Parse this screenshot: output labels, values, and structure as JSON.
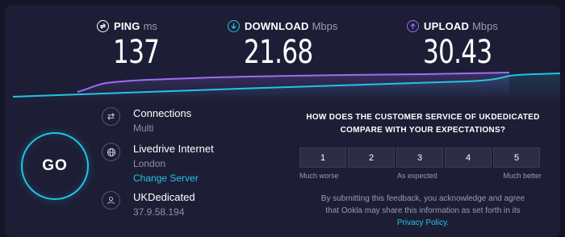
{
  "metrics": {
    "ping": {
      "label": "PING",
      "unit": "ms",
      "value": "137",
      "icon": "ping-icon",
      "color": "#ffffff"
    },
    "download": {
      "label": "DOWNLOAD",
      "unit": "Mbps",
      "value": "21.68",
      "icon": "download-arrow-icon",
      "color": "#24c3e3"
    },
    "upload": {
      "label": "UPLOAD",
      "unit": "Mbps",
      "value": "30.43",
      "icon": "upload-arrow-icon",
      "color": "#9b6ef3"
    }
  },
  "go_label": "GO",
  "connections": {
    "title": "Connections",
    "value": "Multi",
    "icon": "connections-icon"
  },
  "server": {
    "name": "Livedrive Internet",
    "location": "London",
    "change_label": "Change Server",
    "icon": "globe-icon"
  },
  "provider": {
    "name": "UKDedicated",
    "ip": "37.9.58.194",
    "icon": "user-icon"
  },
  "survey": {
    "question_line1": "HOW DOES THE CUSTOMER SERVICE OF UKDEDICATED",
    "question_line2": "COMPARE WITH YOUR EXPECTATIONS?",
    "options": [
      "1",
      "2",
      "3",
      "4",
      "5"
    ],
    "low_label": "Much worse",
    "mid_label": "As expected",
    "high_label": "Much better",
    "disclaimer_line1": "By submitting this feedback, you acknowledge and agree",
    "disclaimer_line2": "that Ookla may share this information as set forth in its",
    "privacy_link": "Privacy Policy",
    "disclaimer_end": "."
  },
  "colors": {
    "accent": "#24c3e3",
    "upload": "#9b6ef3",
    "background": "#1d1e36"
  }
}
